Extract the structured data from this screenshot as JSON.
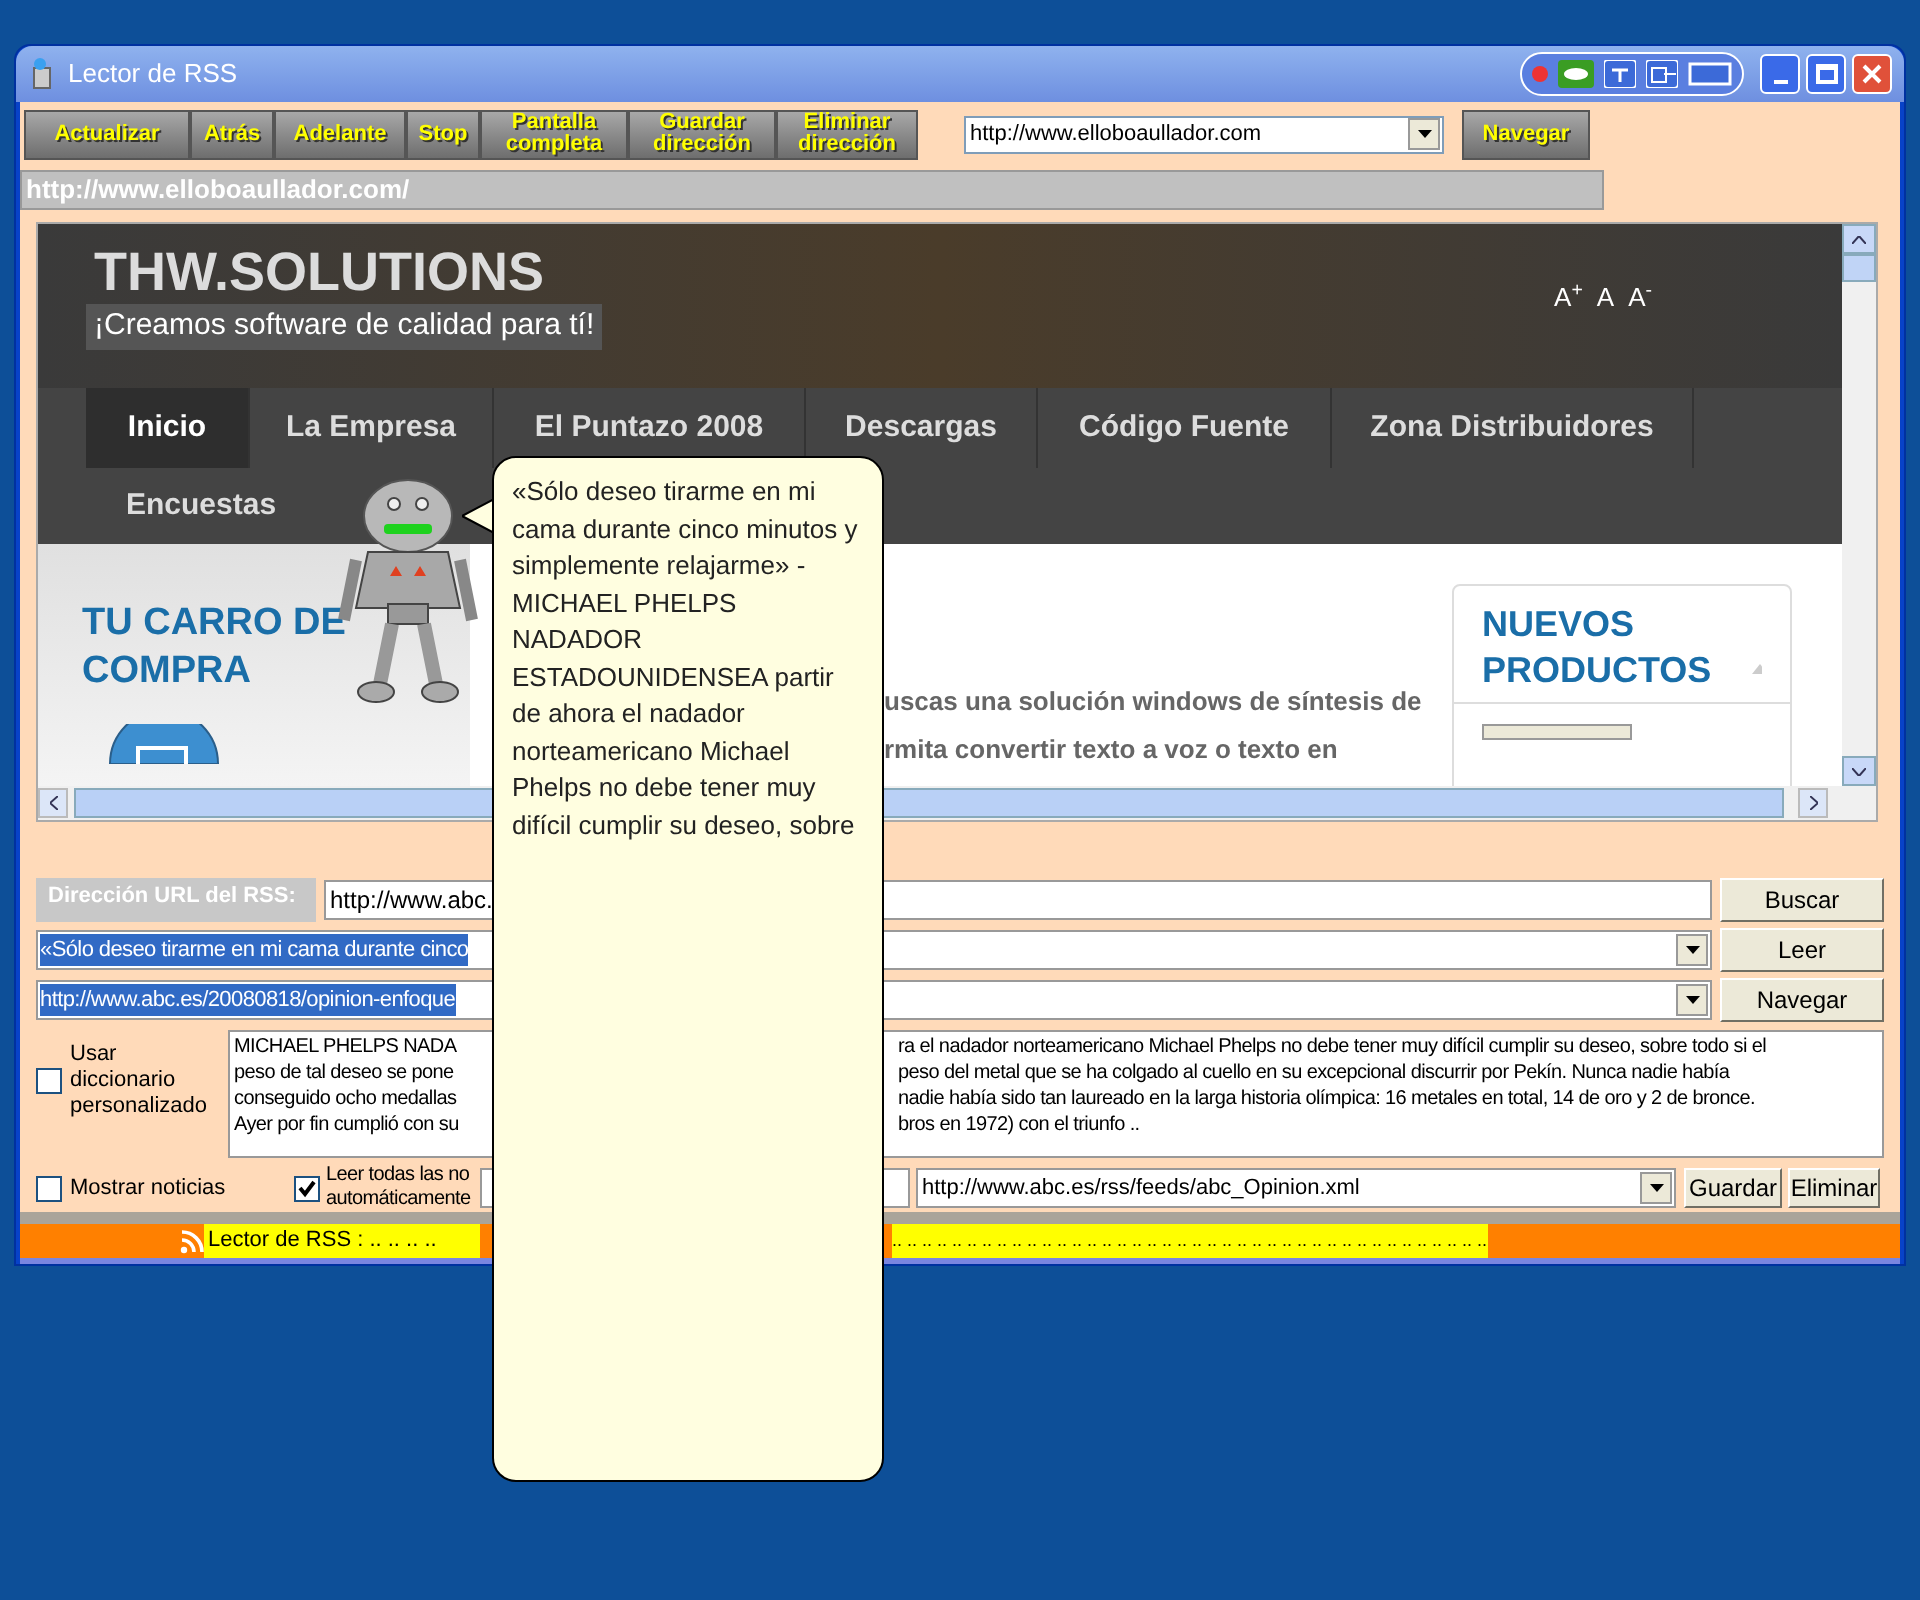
{
  "window": {
    "title": "Lector de RSS"
  },
  "toolbar": {
    "buttons": [
      {
        "label": "Actualizar"
      },
      {
        "label": "Atrás"
      },
      {
        "label": "Adelante"
      },
      {
        "label": "Stop"
      },
      {
        "label": "Pantalla completa"
      },
      {
        "label": "Guardar dirección"
      },
      {
        "label": "Eliminar dirección"
      }
    ],
    "url_combo": "http://www.elloboaullador.com",
    "navigate": "Navegar"
  },
  "address_bar": "http://www.elloboaullador.com/",
  "web_page": {
    "site_title": "THW.SOLUTIONS",
    "tagline": "¡Creamos software de calidad para tí!",
    "font_controls": [
      "A$^{+}$",
      "A",
      "A$^{-}$"
    ],
    "nav": [
      {
        "label": "Inicio",
        "selected": true
      },
      {
        "label": "La Empresa",
        "selected": false
      },
      {
        "label": "El Puntazo 2008",
        "selected": false
      },
      {
        "label": "Descargas",
        "selected": false
      },
      {
        "label": "Código Fuente",
        "selected": false
      },
      {
        "label": "Zona Distribuidores",
        "selected": false
      },
      {
        "label": "Encuestas",
        "selected": false
      }
    ],
    "cart_title": "TU CARRO DE COMPRA",
    "content_lines": [
      "uscas una solución windows de síntesis de",
      "rmita convertir texto a voz o texto en"
    ],
    "sidebar_title": "NUEVOS PRODUCTOS"
  },
  "rss_panel": {
    "url_label": "Dirección URL del RSS:",
    "url_value": "http://www.abc.",
    "item_combo": "«Sólo deseo tirarme en mi cama durante cinco",
    "link_combo": "http://www.abc.es/20080818/opinion-enfoque",
    "buttons": [
      "Buscar",
      "Leer",
      "Navegar"
    ],
    "custom_dictionary": {
      "label": "Usar diccionario personalizado",
      "checked": false
    },
    "body_lines": [
      [
        "MICHAEL PHELPS  NADA",
        "ra el nadador norteamericano Michael Phelps no debe tener muy difícil cumplir su deseo, sobre todo si el"
      ],
      [
        "peso de tal deseo se pone",
        "peso del metal que se ha colgado al cuello en su excepcional discurrir por Pekín. Nunca nadie había"
      ],
      [
        "conseguido ocho medallas",
        "nadie había sido tan laureado en la larga historia olímpica: 16 metales en total, 14 de oro y 2 de bronce."
      ],
      [
        "Ayer por fin cumplió con su",
        "bros en 1972) con el triunfo  .."
      ]
    ],
    "show_news": {
      "label": "Mostrar noticias",
      "checked": false
    },
    "read_all": {
      "label_lines": [
        "Leer todas las no",
        "automáticamente"
      ],
      "checked": true
    },
    "feed_combo": "http://www.abc.es/rss/feeds/abc_Opinion.xml",
    "feed_buttons": [
      "Guardar",
      "Eliminar"
    ]
  },
  "status_bar": "Lector de RSS : .. .. .. ..",
  "status_bar_right": ".. .. .. .. .. .. .. .. .. .. .. .. .. .. .. .. .. .. .. .. .. .. .. .. .. .. .. .. .. .. .. .. .. .. .. .. .. .. .. ..",
  "balloon": "«Sólo deseo tirarme en mi cama durante cinco minutos y simplemente relajarme» - MICHAEL PHELPS NADADOR ESTADOUNIDENSEA partir de ahora el nadador norteamericano Michael Phelps no debe tener muy difícil cumplir su deseo, sobre"
}
